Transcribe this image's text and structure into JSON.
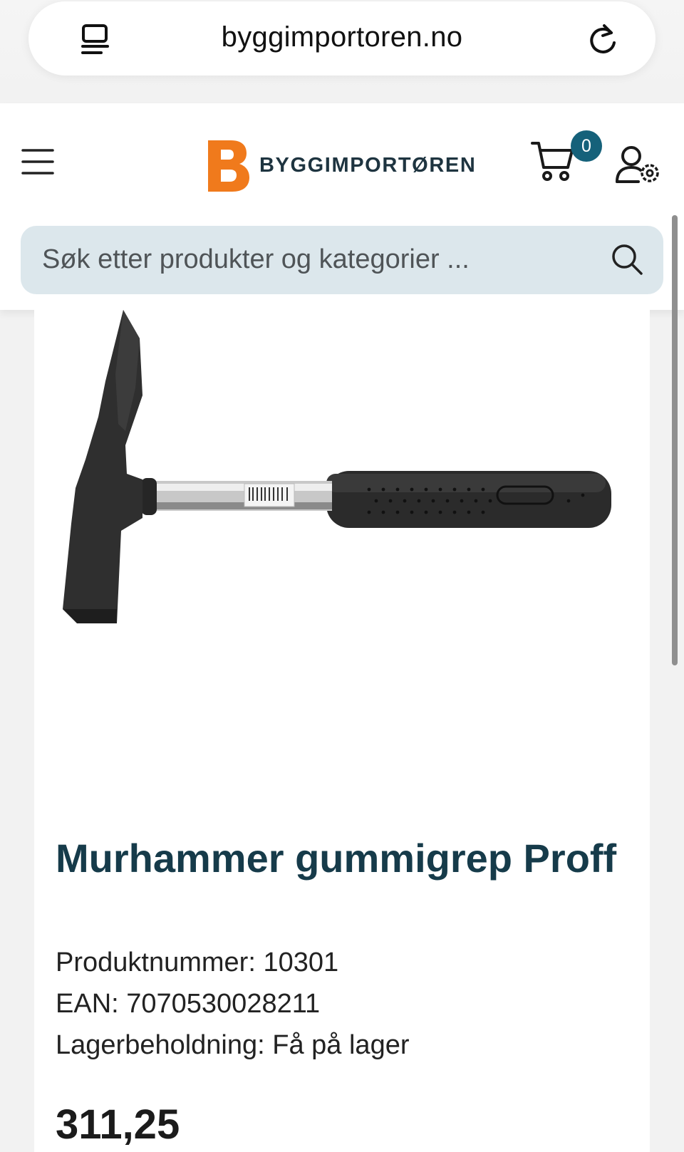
{
  "browser": {
    "url": "byggimportoren.no",
    "icons": {
      "reader": "reader-mode-icon",
      "reload": "reload-icon"
    }
  },
  "header": {
    "logo_text": "BYGGIMPORTØREN",
    "logo_letter": "B",
    "cart_count": "0",
    "icons": {
      "menu": "hamburger-menu-icon",
      "cart": "cart-icon",
      "account": "user-settings-icon"
    },
    "colors": {
      "brand_orange": "#f07a1c",
      "brand_dark": "#1e3440",
      "badge": "#15617a"
    }
  },
  "search": {
    "placeholder": "Søk etter produkter og kategorier ..."
  },
  "product": {
    "title": "Murhammer gummigrep Proff",
    "product_number": "Produktnummer: 10301",
    "ean": "EAN: 7070530028211",
    "stock": "Lagerbeholdning: Få på lager",
    "price": "311,25",
    "colors": {
      "title": "#163b4a"
    }
  }
}
